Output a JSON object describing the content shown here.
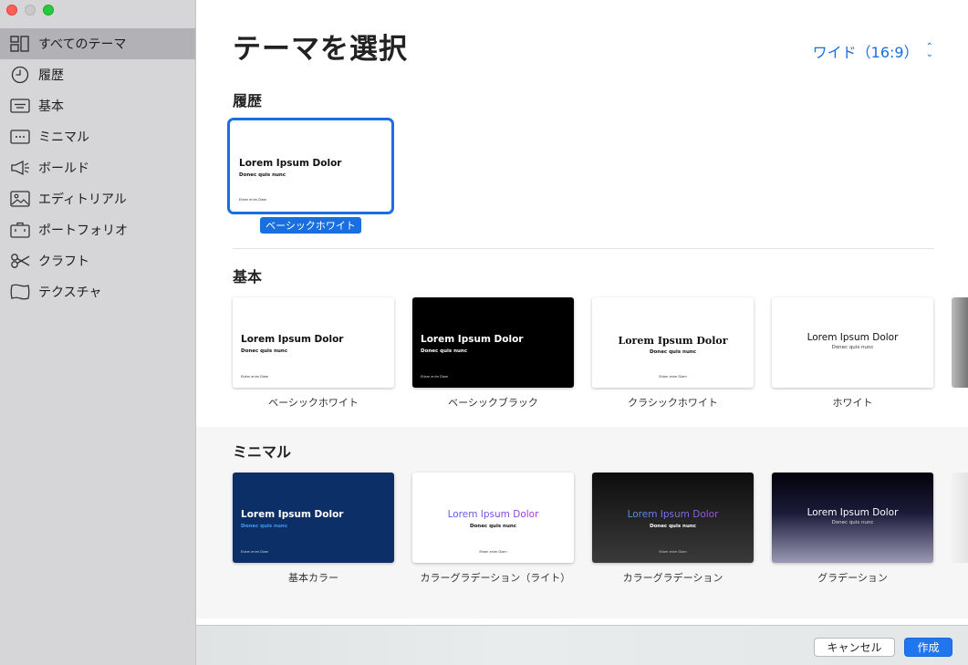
{
  "window": {
    "title": "テーマを選択"
  },
  "sidebar": {
    "items": [
      {
        "label": "すべてのテーマ",
        "icon": "grid-icon",
        "selected": true
      },
      {
        "label": "履歴",
        "icon": "clock-icon"
      },
      {
        "label": "基本",
        "icon": "text-box-icon"
      },
      {
        "label": "ミニマル",
        "icon": "dots-box-icon"
      },
      {
        "label": "ボールド",
        "icon": "megaphone-icon"
      },
      {
        "label": "エディトリアル",
        "icon": "image-icon"
      },
      {
        "label": "ポートフォリオ",
        "icon": "briefcase-icon"
      },
      {
        "label": "クラフト",
        "icon": "scissors-icon"
      },
      {
        "label": "テクスチャ",
        "icon": "texture-frame-icon"
      }
    ]
  },
  "header": {
    "title": "テーマを選択",
    "aspect": "ワイド（16:9）"
  },
  "sections": {
    "history": {
      "title": "履歴",
      "themes": [
        {
          "label": "ベーシックホワイト",
          "t1": "Lorem Ipsum Dolor",
          "t2": "Donec quis nunc",
          "t3": "Etiam enim Diam"
        }
      ]
    },
    "basic": {
      "title": "基本",
      "themes": [
        {
          "label": "ベーシックホワイト",
          "t1": "Lorem Ipsum Dolor",
          "t2": "Donec quis nunc",
          "t3": "Etiam enim Diam"
        },
        {
          "label": "ベーシックブラック",
          "t1": "Lorem Ipsum Dolor",
          "t2": "Donec quis nunc",
          "t3": "Etiam enim Diam"
        },
        {
          "label": "クラシックホワイト",
          "t1": "Lorem Ipsum Dolor",
          "t2": "Donec quis nunc",
          "t3": "Etiam enim Diam"
        },
        {
          "label": "ホワイト",
          "t1": "Lorem Ipsum Dolor",
          "t2": "Donec quis nunc",
          "t3": ""
        }
      ]
    },
    "minimal": {
      "title": "ミニマル",
      "themes": [
        {
          "label": "基本カラー",
          "t1": "Lorem Ipsum Dolor",
          "t2": "Donec quis nunc",
          "t3": "Etiam enim Diam"
        },
        {
          "label": "カラーグラデーション（ライト）",
          "t1": "Lorem Ipsum Dolor",
          "t2": "Donec quis nunc",
          "t3": "Etiam enim Diam"
        },
        {
          "label": "カラーグラデーション",
          "t1": "Lorem Ipsum Dolor",
          "t2": "Donec quis nunc",
          "t3": "Etiam enim Diam"
        },
        {
          "label": "グラデーション",
          "t1": "Lorem Ipsum Dolor",
          "t2": "Donec quis nunc",
          "t3": ""
        }
      ]
    }
  },
  "footer": {
    "cancel_label": "キャンセル",
    "create_label": "作成"
  },
  "colors": {
    "accent": "#1a6fe0",
    "sidebar_bg": "#d6d6d8",
    "sidebar_selected": "#b2b2b6"
  }
}
